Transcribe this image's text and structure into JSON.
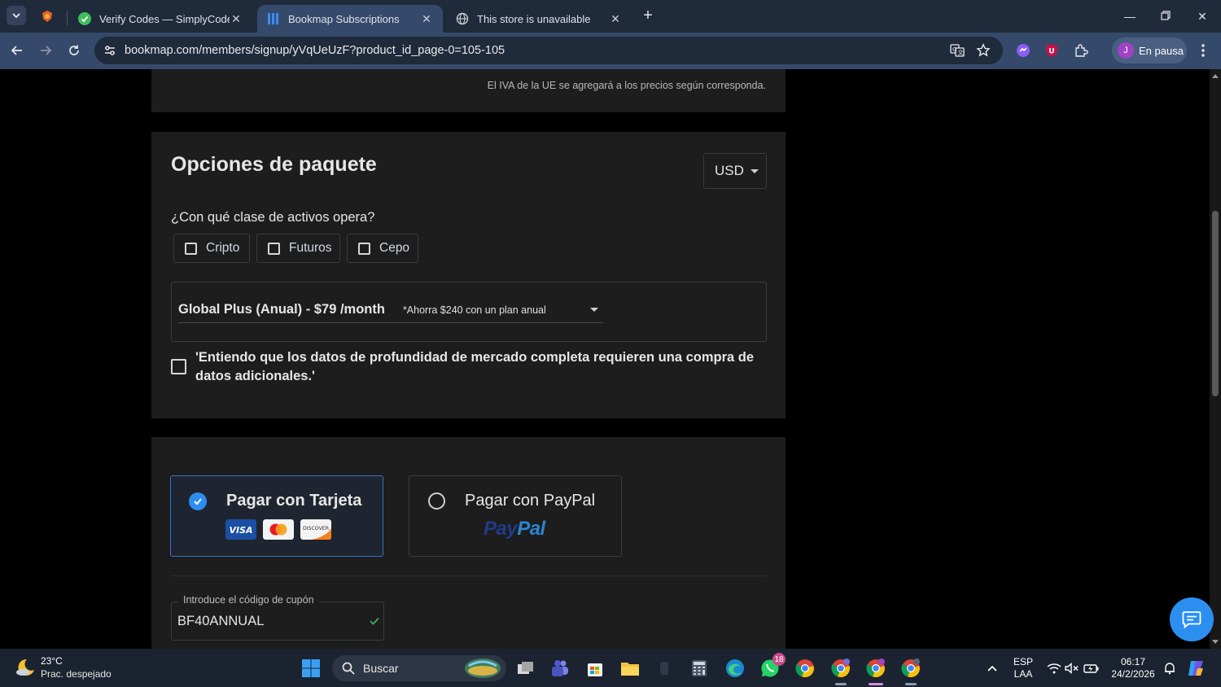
{
  "browser": {
    "tabs": [
      {
        "title": "Verify Codes — SimplyCodes",
        "icon": "simplycodes-icon"
      },
      {
        "title": "Bookmap Subscriptions",
        "icon": "bookmap-icon"
      },
      {
        "title": "This store is unavailable",
        "icon": "globe-icon"
      }
    ],
    "url": "bookmap.com/members/signup/yVqUeUzF?product_id_page-0=105-105",
    "profile_initial": "J",
    "profile_label": "En pausa"
  },
  "page": {
    "vat_note": "El IVA de la UE se agregará a los precios según corresponda.",
    "package": {
      "heading": "Opciones de paquete",
      "currency": "USD",
      "question": "¿Con qué clase de activos opera?",
      "assets": [
        "Cripto",
        "Futuros",
        "Cepo"
      ],
      "plan_name": "Global Plus (Anual) - $79 /month",
      "plan_saving": "*Ahorra $240 con un plan anual",
      "agreement": "'Entiendo que los datos de profundidad de mercado completa requieren una compra de datos adicionales.'"
    },
    "payment": {
      "card_label": "Pagar con Tarjeta",
      "paypal_label": "Pagar con PayPal",
      "paypal_logo": "PayPal",
      "card_brands": [
        "VISA",
        "MASTERCARD",
        "DISCOVER"
      ],
      "coupon_label": "Introduce el código de cupón",
      "coupon_value": "BF40ANNUAL"
    }
  },
  "taskbar": {
    "temperature": "23°C",
    "condition": "Prac. despejado",
    "search_placeholder": "Buscar",
    "whatsapp_badge": "18",
    "language_top": "ESP",
    "language_bottom": "LAA",
    "time": "06:17",
    "date": "24/2/2026"
  },
  "colors": {
    "accent": "#2d8ef0",
    "card_bg": "#1d1d1d",
    "tab_active": "#354a6a",
    "tab_strip": "#1f2a3b"
  }
}
